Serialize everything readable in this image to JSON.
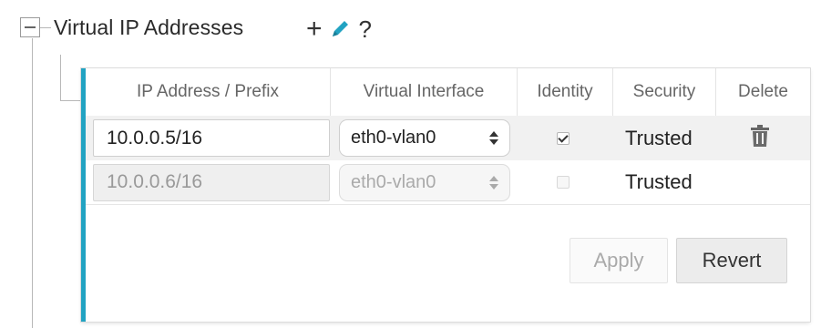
{
  "section": {
    "title": "Virtual IP Addresses",
    "add_symbol": "+",
    "help_symbol": "?",
    "accent_color": "#22a3c2"
  },
  "table": {
    "headers": [
      "IP Address / Prefix",
      "Virtual Interface",
      "Identity",
      "Security",
      "Delete"
    ],
    "rows": [
      {
        "ip": "10.0.0.5/16",
        "interface": "eth0-vlan0",
        "identity_checked": true,
        "security": "Trusted",
        "deletable": true,
        "enabled": true
      },
      {
        "ip": "10.0.0.6/16",
        "interface": "eth0-vlan0",
        "identity_checked": false,
        "security": "Trusted",
        "deletable": false,
        "enabled": false
      }
    ]
  },
  "buttons": {
    "apply": "Apply",
    "revert": "Revert"
  },
  "icons": {
    "collapse": "minus-box-icon",
    "add": "plus-icon",
    "edit": "pencil-icon",
    "help": "question-mark-icon",
    "delete": "trash-icon",
    "select_arrow": "updown-arrows-icon"
  }
}
